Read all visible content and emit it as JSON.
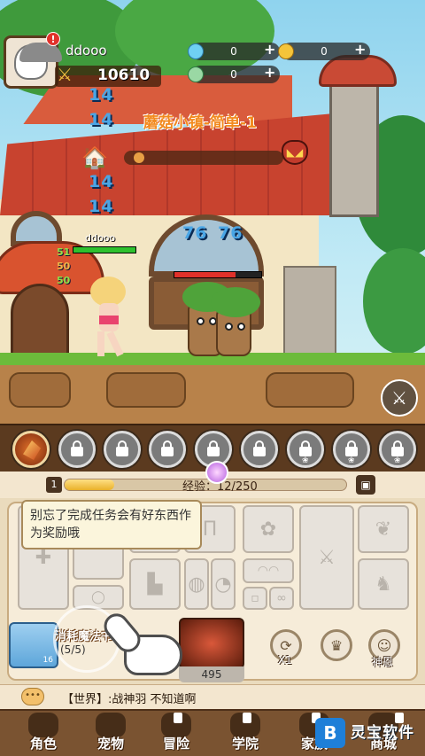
{
  "hud": {
    "player_name": "ddooo",
    "alert_badge": "!",
    "combat_power": "10610",
    "currency": [
      {
        "icon": "diamond-icon",
        "value": "0",
        "plus": "+"
      },
      {
        "icon": "gold-coin-icon",
        "value": "0",
        "plus": "+"
      },
      {
        "icon": "gem-icon",
        "value": "0",
        "plus": "+"
      }
    ]
  },
  "stage": {
    "title": "蘑菇小镇-简单-1",
    "progress_percent": 3
  },
  "damage_numbers": [
    "14",
    "14",
    "14",
    "14",
    "76",
    "76"
  ],
  "hero": {
    "name": "ddooo",
    "hp_percent": 100,
    "stats": [
      "51",
      "50",
      "50"
    ]
  },
  "enemy": {
    "hp_percent": 70
  },
  "skills": {
    "active_icon": "flame-slash-icon",
    "locked_count": 9
  },
  "exp": {
    "level": "1",
    "label": "经验：",
    "value": "12/250",
    "fill_percent": 5
  },
  "equipment": {
    "tip": "别忘了完成任务会有好东西作为奖励哦",
    "potion_name": "消耗魔法书",
    "potion_count": "(5/5)",
    "potion_level": "16",
    "weapon_value": "495",
    "buttons": [
      {
        "icon": "refresh-icon",
        "label": "X1"
      },
      {
        "icon": "crown-icon",
        "label": ""
      },
      {
        "icon": "angel-icon",
        "label": "神恩"
      }
    ]
  },
  "chat": {
    "icon_text": "•••",
    "message": "【世界】:战神羽  不知道啊"
  },
  "nav": [
    {
      "label": "角色",
      "icon": "character-icon"
    },
    {
      "label": "宠物",
      "icon": "pet-icon"
    },
    {
      "label": "冒险",
      "icon": "adventure-icon"
    },
    {
      "label": "学院",
      "icon": "academy-icon"
    },
    {
      "label": "家族",
      "icon": "family-icon"
    },
    {
      "label": "商城",
      "icon": "shop-icon"
    }
  ],
  "watermark": {
    "logo": "B",
    "text": "灵宝软件"
  }
}
